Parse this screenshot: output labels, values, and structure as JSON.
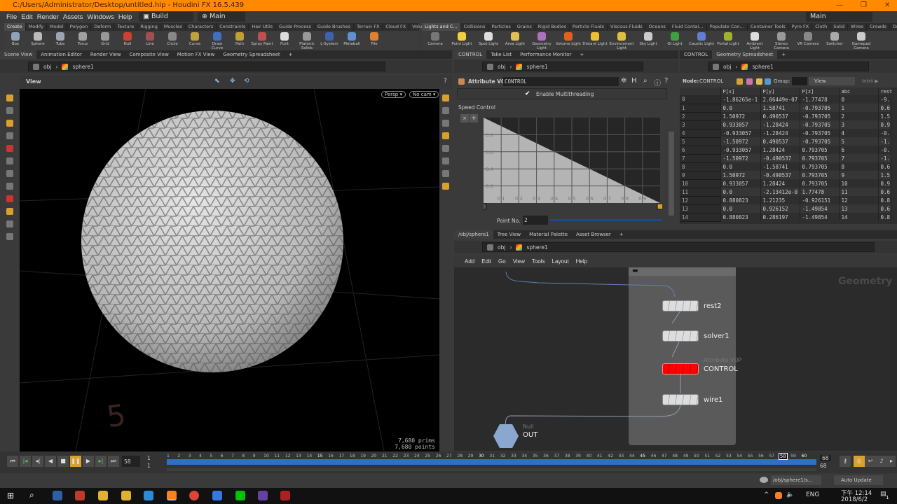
{
  "window": {
    "title": "C:/Users/Administrator/Desktop/untitled.hip - Houdini FX 16.5.439",
    "minimize": "—",
    "maximize": "❐",
    "close": "✕"
  },
  "menu": [
    "File",
    "Edit",
    "Render",
    "Assets",
    "Windows",
    "Help"
  ],
  "desktop": "Build",
  "desktop2": "Main",
  "desktop3": "Main",
  "shelf_left": {
    "tabs": [
      "Create",
      "Modify",
      "Model",
      "Polygon",
      "Deform",
      "Texture",
      "Rigging",
      "Muscles",
      "Characters",
      "Constraints",
      "Hair Utils",
      "Guide Process",
      "Guide Brushes",
      "Terrain FX",
      "Cloud FX",
      "Volume"
    ],
    "tools": [
      {
        "label": "Box",
        "color": "#8fa3b8"
      },
      {
        "label": "Sphere",
        "color": "#bbbbbb"
      },
      {
        "label": "Tube",
        "color": "#9aa6b3"
      },
      {
        "label": "Torus",
        "color": "#a0a0a0"
      },
      {
        "label": "Grid",
        "color": "#999"
      },
      {
        "label": "Null",
        "color": "#d04030"
      },
      {
        "label": "Line",
        "color": "#a05050"
      },
      {
        "label": "Circle",
        "color": "#888"
      },
      {
        "label": "Curve",
        "color": "#c0a040"
      },
      {
        "label": "Draw Curve",
        "color": "#4070c0"
      },
      {
        "label": "Path",
        "color": "#c0a030"
      },
      {
        "label": "Spray Paint",
        "color": "#c05050"
      },
      {
        "label": "Font",
        "color": "#dddddd"
      },
      {
        "label": "Platonic Solids",
        "color": "#999"
      },
      {
        "label": "L-System",
        "color": "#4060b0"
      },
      {
        "label": "Metaball",
        "color": "#6090d0"
      },
      {
        "label": "File",
        "color": "#e08030"
      }
    ]
  },
  "shelf_right": {
    "tabs": [
      "Lights and C...",
      "Collisions",
      "Particles",
      "Grains",
      "Rigid Bodies",
      "Particle Fluids",
      "Viscous Fluids",
      "Oceans",
      "Fluid Contai...",
      "Populate Con...",
      "Container Tools",
      "Pyro FX",
      "Cloth",
      "Solid",
      "Wires",
      "Crowds",
      "Drive Simula..."
    ],
    "tools": [
      {
        "label": "Camera",
        "color": "#777"
      },
      {
        "label": "Point Light",
        "color": "#f0d040"
      },
      {
        "label": "Spot Light",
        "color": "#ddd"
      },
      {
        "label": "Area Light",
        "color": "#e0c050"
      },
      {
        "label": "Geometry Light",
        "color": "#b070c0"
      },
      {
        "label": "Volume Light",
        "color": "#e06020"
      },
      {
        "label": "Distant Light",
        "color": "#f0c030"
      },
      {
        "label": "Environment Light",
        "color": "#e0c040"
      },
      {
        "label": "Sky Light",
        "color": "#ccc"
      },
      {
        "label": "GI Light",
        "color": "#40a040"
      },
      {
        "label": "Caustic Light",
        "color": "#6080d0"
      },
      {
        "label": "Portal Light",
        "color": "#a0b030"
      },
      {
        "label": "Ambient Light",
        "color": "#ddd"
      },
      {
        "label": "Stereo Camera",
        "color": "#999"
      },
      {
        "label": "VR Camera",
        "color": "#888"
      },
      {
        "label": "Switcher",
        "color": "#aaa"
      },
      {
        "label": "Gamepad Camera",
        "color": "#ccc"
      }
    ]
  },
  "left_pane": {
    "tabs": [
      "Scene View",
      "Animation Editor",
      "Render View",
      "Composite View",
      "Motion FX View",
      "Geometry Spreadsheet"
    ],
    "path": [
      "obj",
      "sphere1"
    ],
    "view_label": "View",
    "persp": "Persp ▾",
    "cam": "No cam ▾",
    "prims": "7,680  prims",
    "points": "7,680 points",
    "watermark": "5"
  },
  "params": {
    "tabs": [
      "CONTROL",
      "Take List",
      "Performance Monitor"
    ],
    "path": [
      "obj",
      "sphere1"
    ],
    "node_type": "Attribute VOP",
    "node_name": "CONTROL",
    "multithread": "Enable Multithreading",
    "ramp_label": "Speed Control",
    "yticks": [
      "0.8",
      "0.6",
      "0.4",
      "0.2"
    ],
    "xticks": [
      "0.1",
      "0.2",
      "0.3",
      "0.4",
      "0.5",
      "0.6",
      "0.7",
      "0.8",
      "0.9"
    ],
    "ramp_points": [
      [
        0,
        1
      ],
      [
        1,
        0
      ]
    ],
    "point_no_label": "Point No.",
    "point_no": "2"
  },
  "spreadsheet": {
    "tabs": [
      "CONTROL",
      "Geometry Spreadsheet"
    ],
    "path": [
      "obj",
      "sphere1"
    ],
    "node_label": "Node:",
    "node": "CONTROL",
    "group_label": "Group:",
    "view": "View",
    "intrinsics": "Intrii ▶",
    "columns": [
      "",
      "P[x]",
      "P[y]",
      "P[z]",
      "abc",
      "rest"
    ],
    "rows": [
      [
        "0",
        "-1.86265e-1",
        "2.06449e-07",
        "-1.77478",
        "0",
        "-9."
      ],
      [
        "1",
        "0.0",
        "1.58741",
        "-0.793705",
        "1",
        "0.6"
      ],
      [
        "2",
        "1.50972",
        "0.490537",
        "-0.793705",
        "2",
        "1.5"
      ],
      [
        "3",
        "0.933057",
        "-1.28424",
        "-0.793705",
        "3",
        "0.9"
      ],
      [
        "4",
        "-0.933057",
        "-1.28424",
        "-0.793705",
        "4",
        "-0."
      ],
      [
        "5",
        "-1.50972",
        "0.490537",
        "-0.793705",
        "5",
        "-1."
      ],
      [
        "6",
        "-0.933057",
        "1.28424",
        "0.793705",
        "6",
        "-0."
      ],
      [
        "7",
        "-1.50972",
        "-0.490537",
        "0.793705",
        "7",
        "-1."
      ],
      [
        "8",
        "0.0",
        "-1.58741",
        "0.793705",
        "8",
        "0.6"
      ],
      [
        "9",
        "1.50972",
        "-0.490537",
        "0.793705",
        "9",
        "1.5"
      ],
      [
        "10",
        "0.933057",
        "1.28424",
        "0.793705",
        "10",
        "0.9"
      ],
      [
        "11",
        "0.0",
        "-2.13412e-0",
        "1.77478",
        "11",
        "0.6"
      ],
      [
        "12",
        "0.880823",
        "1.21235",
        "-0.926151",
        "12",
        "0.8"
      ],
      [
        "13",
        "0.0",
        "0.926152",
        "-1.49854",
        "13",
        "0.6"
      ],
      [
        "14",
        "0.880823",
        "0.286197",
        "-1.49854",
        "14",
        "0.8"
      ]
    ]
  },
  "network": {
    "tabs": [
      "/obj/sphere1",
      "Tree View",
      "Material Palette",
      "Asset Browser"
    ],
    "path": [
      "obj",
      "sphere1"
    ],
    "menu": [
      "Add",
      "Edit",
      "Go",
      "View",
      "Tools",
      "Layout",
      "Help"
    ],
    "context": "Geometry",
    "nodes": {
      "rest2": "rest2",
      "solver1": "solver1",
      "control_type": "Attribute VOP",
      "control": "CONTROL",
      "wire1": "wire1",
      "null_type": "Null",
      "out": "OUT"
    }
  },
  "timeline": {
    "current_frame": "58",
    "start": "1",
    "start2": "1",
    "end": "68",
    "end2": "68",
    "first_label": 1,
    "last_label": 60
  },
  "status": {
    "path": "/obj/sphere1/s...",
    "update": "Auto Update"
  },
  "taskbar": {
    "lang": "ENG",
    "time": "下午 12:14",
    "date": "2018/6/2",
    "notif": "1"
  }
}
